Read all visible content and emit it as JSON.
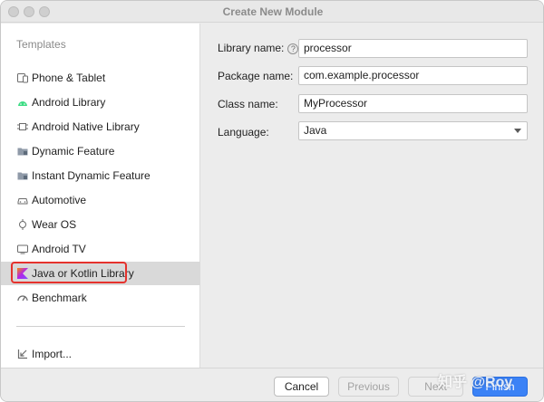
{
  "window": {
    "title": "Create New Module"
  },
  "sidebar": {
    "header": "Templates",
    "items": [
      {
        "label": "Phone & Tablet",
        "icon": "phone-tablet-icon"
      },
      {
        "label": "Android Library",
        "icon": "android-icon"
      },
      {
        "label": "Android Native Library",
        "icon": "native-library-icon"
      },
      {
        "label": "Dynamic Feature",
        "icon": "folder-icon"
      },
      {
        "label": "Instant Dynamic Feature",
        "icon": "folder-icon"
      },
      {
        "label": "Automotive",
        "icon": "car-icon"
      },
      {
        "label": "Wear OS",
        "icon": "watch-icon"
      },
      {
        "label": "Android TV",
        "icon": "tv-icon"
      },
      {
        "label": "Java or Kotlin Library",
        "icon": "kotlin-icon",
        "selected": true
      },
      {
        "label": "Benchmark",
        "icon": "gauge-icon"
      }
    ],
    "import_label": "Import..."
  },
  "form": {
    "library_name_label": "Library name:",
    "library_name_value": "processor",
    "package_name_label": "Package name:",
    "package_name_value": "com.example.processor",
    "class_name_label": "Class name:",
    "class_name_value": "MyProcessor",
    "language_label": "Language:",
    "language_value": "Java"
  },
  "footer": {
    "cancel": "Cancel",
    "previous": "Previous",
    "next": "Next",
    "finish": "Finish"
  },
  "watermark": "知乎 @Roy",
  "colors": {
    "accent": "#3b82f6",
    "selection_box": "#e5322d"
  }
}
